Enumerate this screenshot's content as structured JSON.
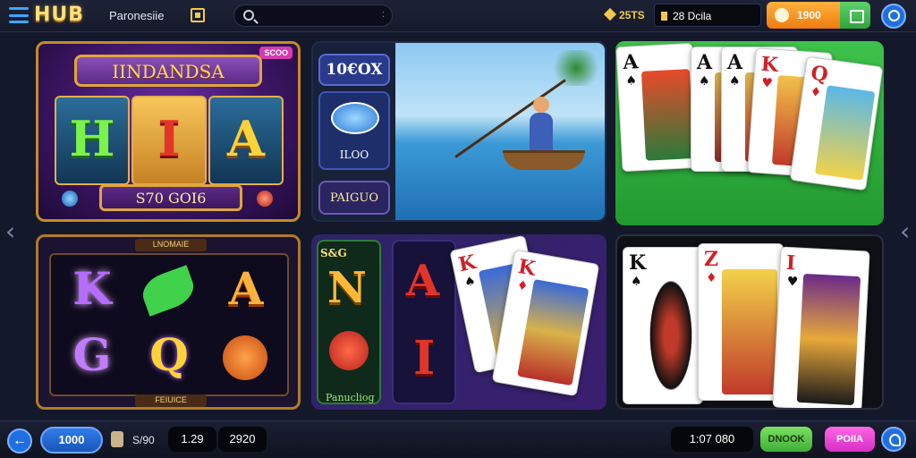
{
  "header": {
    "logo": "HUB",
    "page_name": "Paronesiie",
    "search_placeholder": "",
    "search_dots": ":",
    "coins": "25TS",
    "balance": "28 Dcila",
    "orange_button": "1900"
  },
  "nav": {
    "prev": "‹",
    "next": "‹"
  },
  "tiles": {
    "a": {
      "badge": "SCOO",
      "title": "IINDANDSA",
      "letters": [
        "H",
        "I",
        "A"
      ],
      "value": "S70 GOI6"
    },
    "b": {
      "top": "10€OX",
      "mid": "ILOO",
      "bottom": "PAIGUO"
    },
    "c": {
      "cards": [
        "A",
        "A",
        "A",
        "K",
        "Q"
      ]
    },
    "d": {
      "title": "LNOMAIE",
      "symbols": [
        "K",
        "",
        "A",
        "G",
        "Q",
        ""
      ],
      "bottom": "FEIUICE"
    },
    "e": {
      "corner": "S&G",
      "letters": [
        "N",
        "A",
        "I"
      ],
      "label": "Panucliog",
      "cards": [
        "K",
        "K"
      ]
    },
    "f": {
      "cards": [
        "K",
        "Z",
        "I"
      ]
    }
  },
  "footer": {
    "back": "←",
    "bet": "1000",
    "label1": "S/90",
    "value1": "1.29",
    "value2": "2920",
    "balance": "1:07 080",
    "green_button": "DNOOK",
    "pink_button": "POIIA"
  },
  "colors": {
    "accent_blue": "#1f6fe0",
    "orange": "#f07b10",
    "green": "#3fae38",
    "pink": "#d62ec4"
  }
}
